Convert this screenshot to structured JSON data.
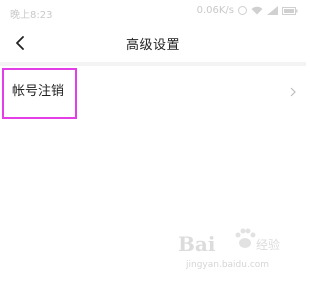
{
  "status_bar": {
    "time": "晚上8:23",
    "network_speed": "0.06K/s",
    "icons": [
      "alarm-icon",
      "wifi-icon",
      "signal-icon",
      "battery-icon"
    ]
  },
  "nav": {
    "back_icon": "back-arrow-icon",
    "title": "高级设置"
  },
  "settings": {
    "items": [
      {
        "label": "帐号注销",
        "icon": "chevron-right-icon"
      }
    ]
  },
  "highlight_color": "#e43ee6",
  "watermark": {
    "logo_text": "Bai",
    "brand": "经验",
    "url": "jingyan.baidu.com"
  }
}
